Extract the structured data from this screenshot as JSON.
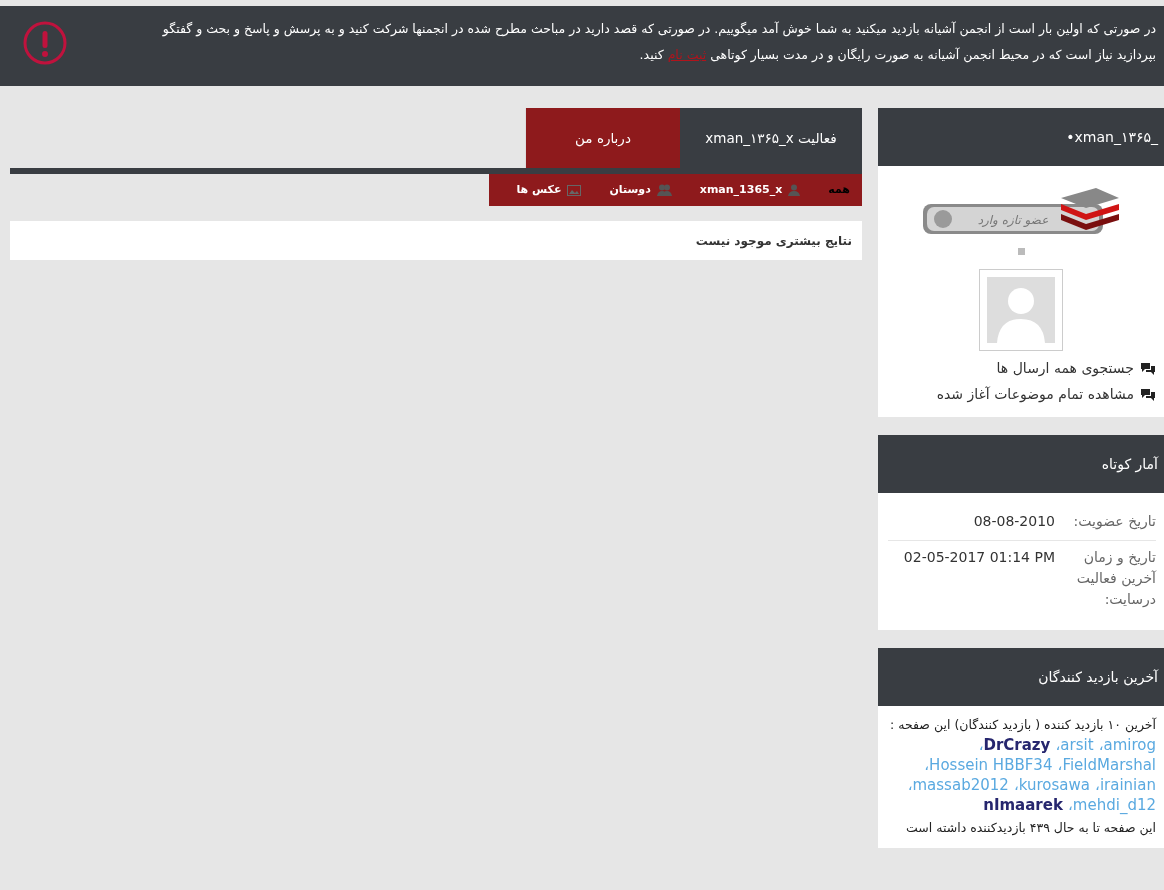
{
  "notice": {
    "text_before": "در صورتی که اولین بار است از انجمن آشیانه بازدید میکنید به شما خوش آمد میگوییم. در صورتی که قصد دارید در مباحث مطرح شده در انجمنها شرکت کنید و به پرسش و پاسخ و بحث و گفتگو بپردازید نیاز است که در محیط انجمن آشیانه به صورت رایگان و در مدت بسیار کوتاهی ",
    "link": "ثبت نام",
    "text_after": " کنید."
  },
  "tabs": [
    {
      "label": "فعالیت xman_۱۳۶۵_x",
      "selected": true
    },
    {
      "label": "درباره من",
      "selected": false
    }
  ],
  "filters": [
    {
      "kind": "plain",
      "label": "همه",
      "selected": true
    },
    {
      "kind": "person",
      "label": "xman_1365_x",
      "selected": false
    },
    {
      "kind": "friends",
      "label": "دوستان",
      "selected": false
    },
    {
      "kind": "photos",
      "label": "عکس ها",
      "selected": false
    }
  ],
  "results_message": "نتایج بیشتری موجود نیست",
  "profile": {
    "title": "xman_۱۳۶۵_",
    "bullet": "•",
    "rank_label": "عضو تازه وارد",
    "links": [
      "جستجوی همه ارسال ها",
      "مشاهده تمام موضوعات آغاز شده"
    ]
  },
  "stats": {
    "title": "آمار کوتاه",
    "rows": [
      {
        "label": "تاریخ عضویت:",
        "value": "08-08-2010"
      },
      {
        "label": "تاریخ و زمان آخرین فعالیت درسایت:",
        "value": "02-05-2017 01:14 PM"
      }
    ]
  },
  "visitors": {
    "title": "آخرین بازدید کنندگان",
    "intro": "آخرین ۱۰ بازدید کننده ( بازدید کنندگان) این صفحه :",
    "names": [
      {
        "name": "amirog",
        "emphasized": false
      },
      {
        "name": "arsit",
        "emphasized": false
      },
      {
        "name": "DrCrazy",
        "emphasized": true
      },
      {
        "name": "FieldMarshal",
        "emphasized": false
      },
      {
        "name": "Hossein HBBF34",
        "emphasized": false
      },
      {
        "name": "irainian",
        "emphasized": false
      },
      {
        "name": "kurosawa",
        "emphasized": false
      },
      {
        "name": "massab2012",
        "emphasized": false
      },
      {
        "name": "mehdi_d12",
        "emphasized": false
      },
      {
        "name": "nImaarek",
        "emphasized": true
      }
    ],
    "separator": "،",
    "footer": "این صفحه تا به حال ۴۳۹ بازدیدکننده داشته است"
  }
}
